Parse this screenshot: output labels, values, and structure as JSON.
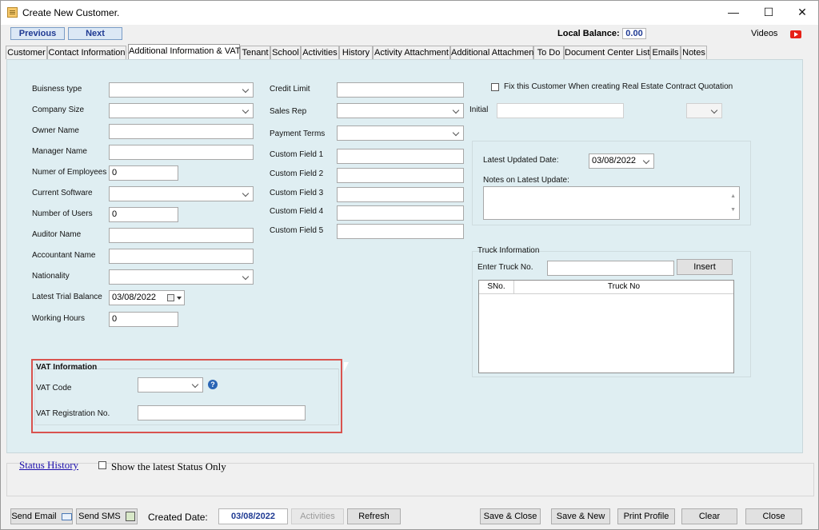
{
  "window": {
    "title": "Create New Customer.",
    "minimize": "—",
    "maximize": "☐",
    "close": "✕"
  },
  "top": {
    "previous": "Previous",
    "next": "Next",
    "local_balance_label": "Local Balance:",
    "local_balance_value": "0.00",
    "videos": "Videos"
  },
  "tabs": [
    "Customer",
    "Contact Information",
    "Additional Information & VAT",
    "Tenant",
    "School",
    "Activities",
    "History",
    "Activity Attachment",
    "Additional Attachment",
    "To Do",
    "Document Center List",
    "Emails",
    "Notes"
  ],
  "left": {
    "business_type": "Buisness type",
    "company_size": "Company Size",
    "owner_name": "Owner Name",
    "manager_name": "Manager Name",
    "num_employees": "Numer of Employees",
    "num_employees_value": "0",
    "current_software": "Current Software",
    "num_users": "Number of Users",
    "num_users_value": "0",
    "auditor_name": "Auditor Name",
    "accountant_name": "Accountant Name",
    "nationality": "Nationality",
    "latest_trial_balance": "Latest Trial Balance",
    "latest_trial_balance_value": "03/08/2022",
    "working_hours": "Working Hours",
    "working_hours_value": "0"
  },
  "middle": {
    "credit_limit": "Credit Limit",
    "sales_rep": "Sales Rep",
    "payment_terms": "Payment Terms",
    "custom1": "Custom Field 1",
    "custom2": "Custom Field 2",
    "custom3": "Custom Field 3",
    "custom4": "Custom Field 4",
    "custom5": "Custom Field 5"
  },
  "right": {
    "fix_customer": "Fix this Customer When creating Real Estate Contract Quotation",
    "initial": "Initial",
    "latest_updated_date": "Latest Updated Date:",
    "latest_updated_date_value": "03/08/2022",
    "notes_latest_update": "Notes on Latest Update:",
    "truck_info": "Truck Information",
    "enter_truck": "Enter Truck No.",
    "insert": "Insert",
    "grid_cols": [
      "SNo.",
      "Truck No"
    ]
  },
  "vat": {
    "title": "VAT Information",
    "vat_code": "VAT Code",
    "vat_reg": "VAT Registration No.",
    "help": "?"
  },
  "status": {
    "history": "Status History",
    "show_latest": "Show the latest Status Only"
  },
  "bottom": {
    "send_email": "Send Email",
    "send_sms": "Send SMS",
    "created_date_label": "Created Date:",
    "created_date_value": "03/08/2022",
    "activities": "Activities",
    "refresh": "Refresh",
    "save_close": "Save & Close",
    "save_new": "Save & New",
    "print_profile": "Print Profile",
    "clear": "Clear",
    "close": "Close"
  },
  "colors": {
    "panel": "#dfeef2",
    "highlight": "#d9534f",
    "link": "#1a0dab"
  }
}
